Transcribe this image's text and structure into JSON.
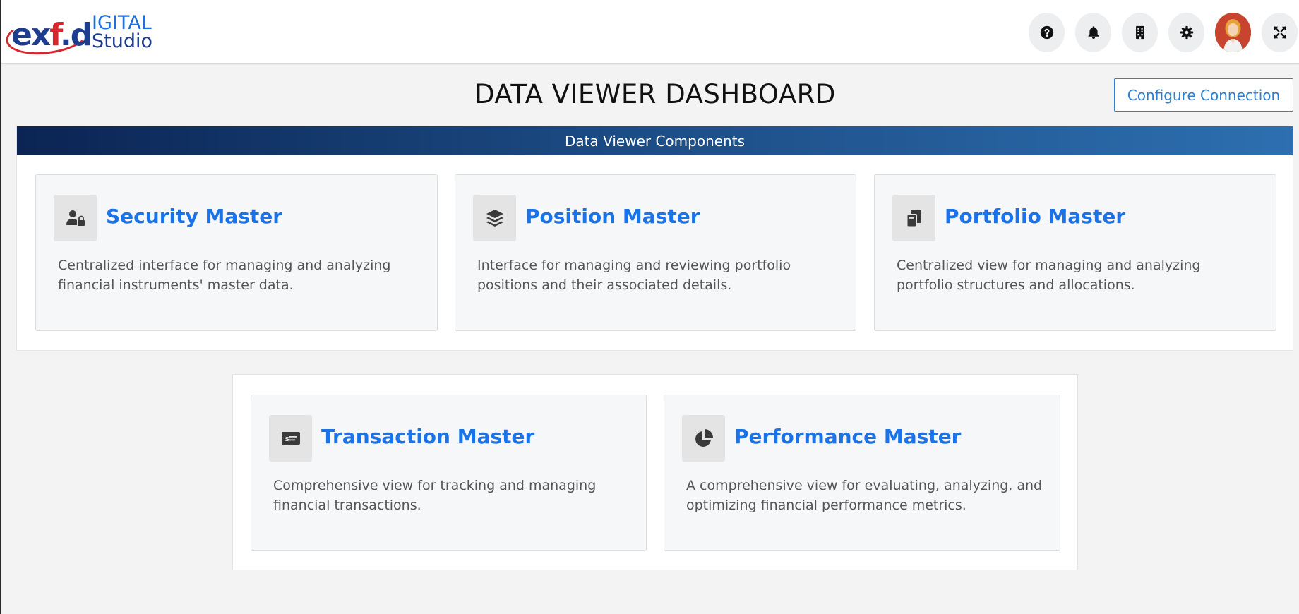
{
  "header": {
    "logo": {
      "main_prefix": "ex",
      "main_accent": "f",
      "main_suffix": ".d",
      "top": "IGITAL",
      "bottom": "Studio"
    },
    "icons": [
      {
        "name": "help-icon"
      },
      {
        "name": "bell-icon"
      },
      {
        "name": "building-icon"
      },
      {
        "name": "gear-icon"
      },
      {
        "name": "user-avatar"
      },
      {
        "name": "expand-icon"
      }
    ]
  },
  "page": {
    "title": "DATA VIEWER DASHBOARD",
    "configure_button": "Configure Connection"
  },
  "section": {
    "banner": "Data Viewer Components"
  },
  "cards": [
    {
      "title": "Security Master",
      "description": "Centralized interface for managing and analyzing financial instruments' master data.",
      "icon": "user-lock-icon"
    },
    {
      "title": "Position Master",
      "description": "Interface for managing and reviewing portfolio positions and their associated details.",
      "icon": "layers-icon"
    },
    {
      "title": "Portfolio Master",
      "description": "Centralized view for managing and analyzing portfolio structures and allocations.",
      "icon": "copy-icon"
    },
    {
      "title": "Transaction Master",
      "description": "Comprehensive view for tracking and managing financial transactions.",
      "icon": "money-check-icon"
    },
    {
      "title": "Performance Master",
      "description": "A comprehensive view for evaluating, analyzing, and optimizing financial performance metrics.",
      "icon": "pie-chart-icon"
    }
  ],
  "colors": {
    "accent": "#1a73e8",
    "banner_start": "#0b2453",
    "banner_end": "#2d6fb0",
    "logo_red": "#d7262e",
    "logo_blue": "#1e3d8f"
  }
}
